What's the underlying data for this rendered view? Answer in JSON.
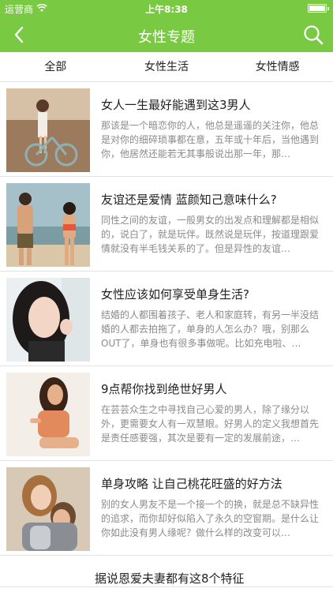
{
  "status_bar": {
    "carrier": "运营商",
    "time": "上午8:38"
  },
  "nav": {
    "title": "女性专题",
    "back_icon": "chevron-left-icon",
    "search_icon": "search-icon"
  },
  "colors": {
    "accent": "#7ac943"
  },
  "tabs": [
    {
      "label": "全部"
    },
    {
      "label": "女性生活"
    },
    {
      "label": "女性情感"
    }
  ],
  "articles": [
    {
      "title": "女人一生最好能遇到这3男人",
      "summary": "那该是一个暗恋你的人，他总是遥遥的关注你，他总是对你的细碎琐事都在意，五年或十年后，当他遇到你，他居然还能若无其事般说出那一年，那…"
    },
    {
      "title": "友谊还是爱情 蓝颜知己意味什么?",
      "summary": "同性之间的友谊，一般男女的出发点和理解都是相似的，说白了，就是玩伴。既然说是玩伴，按道理跟爱情就没有半毛钱关系的了。但是异性的友谊…"
    },
    {
      "title": "女性应该如何享受单身生活?",
      "summary": "结婚的人都围着孩子、老人和家庭转，有另一半没结婚的人都去拍拖了，单身的人怎么办？哦，别那么OUT了，单身也有很多事做呢。比如充电啦、…"
    },
    {
      "title": "9点帮你找到绝世好男人",
      "summary": "在芸芸众生之中寻找自己心爱的男人，除了缘分以外，更需要女人有一双慧眼。好男人的定义我想首先是责任感要强，其次是要有一定的发展前途，…"
    },
    {
      "title": "单身攻略 让自己桃花旺盛的好方法",
      "summary": "别的女人男友不是一个接一个的换，就是总不缺异性的追求，而你却好似陷入了永久的空窗期。是什么让你如此没有男人缘呢？做什么样的改变可以…"
    },
    {
      "title": "据说恩爱夫妻都有这8个特征",
      "summary": ""
    }
  ]
}
